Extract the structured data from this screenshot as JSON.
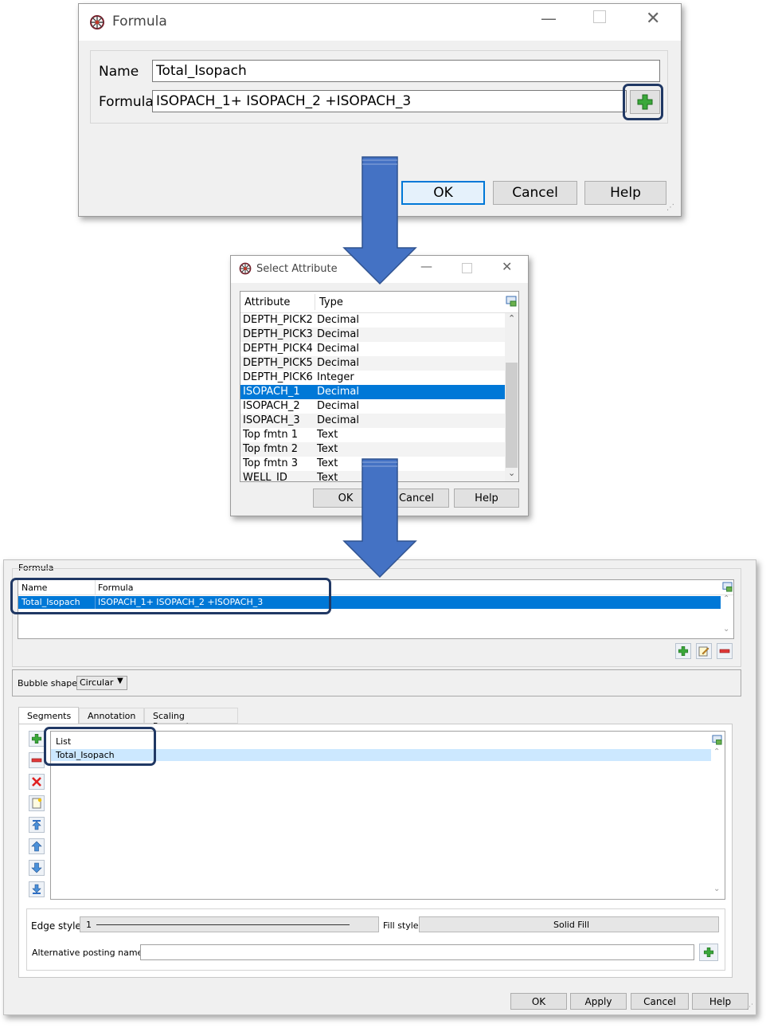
{
  "formula_dialog": {
    "title": "Formula",
    "name_label": "Name",
    "name_value": "Total_Isopach",
    "formula_label": "Formula",
    "formula_value": "ISOPACH_1+ ISOPACH_2 +ISOPACH_3",
    "ok": "OK",
    "cancel": "Cancel",
    "help": "Help"
  },
  "select_dialog": {
    "title": "Select Attribute",
    "col_attribute": "Attribute",
    "col_type": "Type",
    "rows": [
      {
        "attr": "DEPTH_PICK2",
        "type": "Decimal"
      },
      {
        "attr": "DEPTH_PICK3",
        "type": "Decimal"
      },
      {
        "attr": "DEPTH_PICK4",
        "type": "Decimal"
      },
      {
        "attr": "DEPTH_PICK5",
        "type": "Decimal"
      },
      {
        "attr": "DEPTH_PICK6",
        "type": "Integer"
      },
      {
        "attr": "ISOPACH_1",
        "type": "Decimal"
      },
      {
        "attr": "ISOPACH_2",
        "type": "Decimal"
      },
      {
        "attr": "ISOPACH_3",
        "type": "Decimal"
      },
      {
        "attr": "Top fmtn 1",
        "type": "Text"
      },
      {
        "attr": "Top fmtn 2",
        "type": "Text"
      },
      {
        "attr": "Top fmtn 3",
        "type": "Text"
      },
      {
        "attr": "WELL_ID",
        "type": "Text"
      }
    ],
    "selected_index": 5,
    "ok": "OK",
    "cancel": "Cancel",
    "help": "Help"
  },
  "main_panel": {
    "formula_group": "Formula",
    "col_name": "Name",
    "col_formula": "Formula",
    "row_name": "Total_Isopach",
    "row_formula": "ISOPACH_1+ ISOPACH_2 +ISOPACH_3",
    "bubble_label": "Bubble shape",
    "bubble_value": "Circular",
    "tabs": [
      "Segments",
      "Annotation",
      "Scaling Parameters"
    ],
    "list_header": "List",
    "list_item": "Total_Isopach",
    "edge_label": "Edge style",
    "edge_value": "1",
    "fill_label": "Fill style",
    "fill_value": "Solid Fill",
    "alt_label": "Alternative posting name",
    "ok": "OK",
    "apply": "Apply",
    "cancel": "Cancel",
    "help": "Help"
  },
  "colors": {
    "selection": "#0078d7",
    "highlight_border": "#203864",
    "arrow": "#4472c4",
    "plus_green": "#3aa83a"
  }
}
